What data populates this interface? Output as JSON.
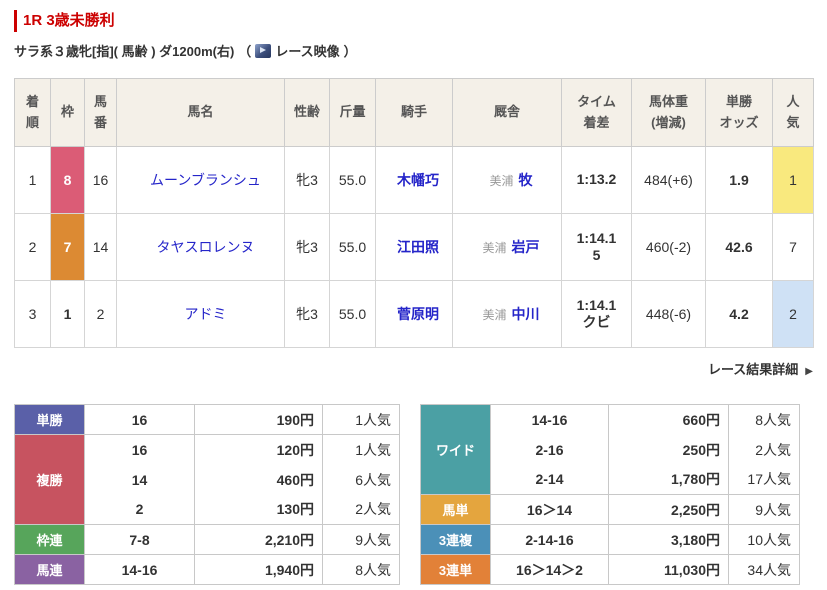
{
  "page": {
    "title": "1R 3歳未勝利",
    "conditions": "サラ系３歳牝[指]( 馬齢 ) ダ1200m(右)",
    "video_open": "（",
    "video_label": "レース映像",
    "video_close": "）",
    "detail_link": "レース結果詳細",
    "detail_arrow": "▶"
  },
  "colors": {
    "title_red": "#cc0000",
    "link_blue": "#2525c9",
    "header_bg": "#f4f0e8"
  },
  "results": {
    "headers": {
      "rank": "着\n順",
      "frame": "枠",
      "number": "馬\n番",
      "horse": "馬名",
      "sexage": "性齢",
      "weight": "斤量",
      "jockey": "騎手",
      "stable": "厩舎",
      "time": "タイム\n着差",
      "body": "馬体重\n(増減)",
      "odds": "単勝\nオッズ",
      "pop": "人\n気"
    },
    "rows": [
      {
        "rank": "1",
        "frame": "8",
        "frame_bg": "#db5c76",
        "frame_fg": "#ffffff",
        "number": "16",
        "horse": "ムーンブランシュ",
        "sexage": "牝3",
        "weight": "55.0",
        "jockey": "木幡巧",
        "region": "美浦",
        "trainer": "牧",
        "time": "1:13.2",
        "margin": "",
        "body": "484(+6)",
        "odds": "1.9",
        "pop": "1",
        "pop_bg": "#f9e97e"
      },
      {
        "rank": "2",
        "frame": "7",
        "frame_bg": "#dc8a33",
        "frame_fg": "#ffffff",
        "number": "14",
        "horse": "タヤスロレンヌ",
        "sexage": "牝3",
        "weight": "55.0",
        "jockey": "江田照",
        "region": "美浦",
        "trainer": "岩戸",
        "time": "1:14.1",
        "margin": "5",
        "body": "460(-2)",
        "odds": "42.6",
        "pop": "7",
        "pop_bg": "#ffffff"
      },
      {
        "rank": "3",
        "frame": "1",
        "frame_bg": "#ffffff",
        "frame_fg": "#333333",
        "number": "2",
        "horse": "アドミ",
        "sexage": "牝3",
        "weight": "55.0",
        "jockey": "菅原明",
        "region": "美浦",
        "trainer": "中川",
        "time": "1:14.1",
        "margin": "クビ",
        "body": "448(-6)",
        "odds": "4.2",
        "pop": "2",
        "pop_bg": "#cfe1f5"
      }
    ]
  },
  "payouts": {
    "left": [
      {
        "type": "単勝",
        "color": "#5a60a8",
        "rows": [
          {
            "combo": "16",
            "amount": "190円",
            "pop": "1人気"
          }
        ]
      },
      {
        "type": "複勝",
        "color": "#c75360",
        "rows": [
          {
            "combo": "16",
            "amount": "120円",
            "pop": "1人気"
          },
          {
            "combo": "14",
            "amount": "460円",
            "pop": "6人気"
          },
          {
            "combo": "2",
            "amount": "130円",
            "pop": "2人気"
          }
        ]
      },
      {
        "type": "枠連",
        "color": "#57a55b",
        "rows": [
          {
            "combo": "7-8",
            "amount": "2,210円",
            "pop": "9人気"
          }
        ]
      },
      {
        "type": "馬連",
        "color": "#8a62a2",
        "rows": [
          {
            "combo": "14-16",
            "amount": "1,940円",
            "pop": "8人気"
          }
        ]
      }
    ],
    "right": [
      {
        "type": "ワイド",
        "color": "#4ba0a4",
        "rows": [
          {
            "combo": "14-16",
            "amount": "660円",
            "pop": "8人気"
          },
          {
            "combo": "2-16",
            "amount": "250円",
            "pop": "2人気"
          },
          {
            "combo": "2-14",
            "amount": "1,780円",
            "pop": "17人気"
          }
        ]
      },
      {
        "type": "馬単",
        "color": "#e4a53e",
        "rows": [
          {
            "combo": "16＞14",
            "amount": "2,250円",
            "pop": "9人気"
          }
        ]
      },
      {
        "type": "3連複",
        "color": "#4b90b8",
        "rows": [
          {
            "combo": "2-14-16",
            "amount": "3,180円",
            "pop": "10人気"
          }
        ]
      },
      {
        "type": "3連単",
        "color": "#e28138",
        "rows": [
          {
            "combo": "16＞14＞2",
            "amount": "11,030円",
            "pop": "34人気"
          }
        ]
      }
    ]
  }
}
